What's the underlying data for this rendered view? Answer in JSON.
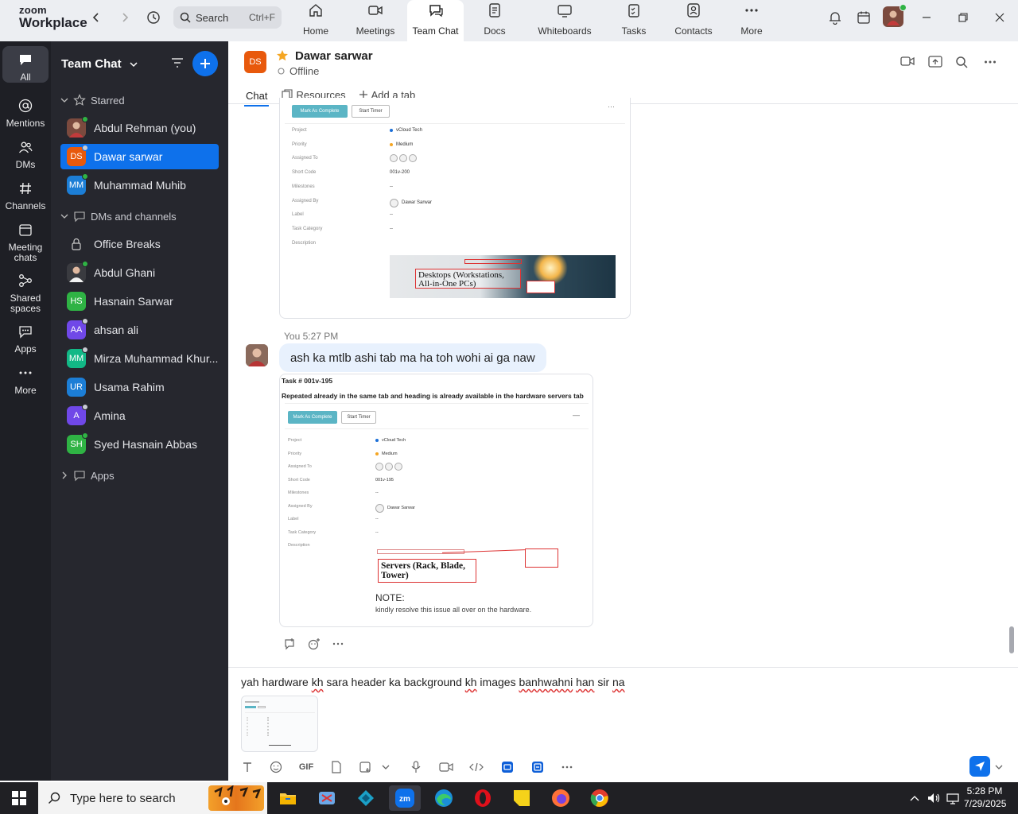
{
  "brand": {
    "line1": "zoom",
    "line2": "Workplace"
  },
  "search": {
    "placeholder": "Search",
    "shortcut": "Ctrl+F"
  },
  "nav_tabs": [
    {
      "label": "Home",
      "icon": "home-icon"
    },
    {
      "label": "Meetings",
      "icon": "video-icon"
    },
    {
      "label": "Team Chat",
      "icon": "chat-icon",
      "active": true
    },
    {
      "label": "Docs",
      "icon": "doc-icon"
    },
    {
      "label": "Whiteboards",
      "icon": "whiteboard-icon"
    },
    {
      "label": "Tasks",
      "icon": "tasks-icon"
    },
    {
      "label": "Contacts",
      "icon": "contacts-icon"
    },
    {
      "label": "More",
      "icon": "more-icon"
    }
  ],
  "rail": [
    {
      "label": "All",
      "icon": "chat-bubble-icon",
      "active": true
    },
    {
      "label": "Mentions",
      "icon": "at-icon"
    },
    {
      "label": "DMs",
      "icon": "people-icon"
    },
    {
      "label": "Channels",
      "icon": "hash-icon"
    },
    {
      "label": "Meeting chats",
      "icon": "calendar-icon"
    },
    {
      "label": "Shared spaces",
      "icon": "share-icon"
    },
    {
      "label": "Apps",
      "icon": "apps-icon"
    },
    {
      "label": "More",
      "icon": "more-icon"
    }
  ],
  "sidebar": {
    "title": "Team Chat",
    "starred_label": "Starred",
    "dms_label": "DMs and channels",
    "apps_label": "Apps",
    "starred": [
      {
        "name": "Abdul Rehman (you)",
        "initials": "",
        "color": "#7b4a3e",
        "status": "#2fb344"
      },
      {
        "name": "Dawar sarwar",
        "initials": "DS",
        "color": "#e8590c",
        "status": "#c9ccd3",
        "selected": true
      },
      {
        "name": "Muhammad Muhib",
        "initials": "MM",
        "color": "#1c7ed6",
        "status": "#2fb344"
      }
    ],
    "dms": [
      {
        "name": "Office Breaks",
        "initials": "",
        "color": "",
        "lock": true
      },
      {
        "name": "Abdul Ghani",
        "initials": "",
        "color": "#3a3b40",
        "status": "#2fb344"
      },
      {
        "name": "Hasnain Sarwar",
        "initials": "HS",
        "color": "#2fb344",
        "status": ""
      },
      {
        "name": "ahsan ali",
        "initials": "AA",
        "color": "#7048e8",
        "status": "#c9ccd3"
      },
      {
        "name": "Mirza Muhammad Khur...",
        "initials": "MM",
        "color": "#12b886",
        "status": "#c9ccd3"
      },
      {
        "name": "Usama Rahim",
        "initials": "UR",
        "color": "#1c7ed6",
        "status": ""
      },
      {
        "name": "Amina",
        "initials": "A",
        "color": "#7048e8",
        "status": "#c9ccd3"
      },
      {
        "name": "Syed Hasnain Abbas",
        "initials": "SH",
        "color": "#2fb344",
        "status": "#2fb344"
      }
    ]
  },
  "chat": {
    "contact_initials": "DS",
    "contact_name": "Dawar sarwar",
    "contact_status": "Offline",
    "tabs": {
      "chat": "Chat",
      "resources": "Resources",
      "add": "Add a tab"
    }
  },
  "card1": {
    "buttons": {
      "complete": "Mark As Complete",
      "timer": "Start Timer"
    },
    "fields": [
      {
        "label": "Project",
        "value": "vCloud Tech"
      },
      {
        "label": "Priority",
        "value": "Medium"
      },
      {
        "label": "Assigned To",
        "value": ""
      },
      {
        "label": "Short Code",
        "value": "001v-200"
      },
      {
        "label": "Milestones",
        "value": "--"
      },
      {
        "label": "Assigned By",
        "value": "Dawar Sarwar"
      },
      {
        "label": "Label",
        "value": "--"
      },
      {
        "label": "Task Category",
        "value": "--"
      },
      {
        "label": "Description",
        "value": ""
      }
    ],
    "banner_text": "Desktops (Workstations, All-in-One PCs)"
  },
  "message": {
    "sender": "You",
    "time": "5:27 PM",
    "text": "ash ka mtlb ashi tab ma ha toh wohi ai ga naw"
  },
  "card2": {
    "task_no": "Task # 001v-195",
    "title": "Repeated already in the same tab and heading is already available in the hardware servers tab",
    "buttons": {
      "complete": "Mark As Complete",
      "timer": "Start Timer"
    },
    "fields": [
      {
        "label": "Project",
        "value": "vCloud Tech"
      },
      {
        "label": "Priority",
        "value": "Medium"
      },
      {
        "label": "Assigned To",
        "value": ""
      },
      {
        "label": "Short Code",
        "value": "001v-195"
      },
      {
        "label": "Milestones",
        "value": "--"
      },
      {
        "label": "Assigned By",
        "value": "Dawar Sarwar"
      },
      {
        "label": "Label",
        "value": "--"
      },
      {
        "label": "Task Category",
        "value": "--"
      },
      {
        "label": "Description",
        "value": ""
      }
    ],
    "banner_text": "Servers (Rack, Blade, Tower)",
    "note_title": "NOTE:",
    "note_text": "kindly resolve this issue all over on the hardware."
  },
  "compose": {
    "text_parts": [
      {
        "t": "yah hardware ",
        "sq": false
      },
      {
        "t": "kh",
        "sq": true
      },
      {
        "t": " sara header ka background ",
        "sq": false
      },
      {
        "t": "kh",
        "sq": true
      },
      {
        "t": " images ",
        "sq": false
      },
      {
        "t": "banhwahni",
        "sq": true
      },
      {
        "t": " ",
        "sq": false
      },
      {
        "t": "han",
        "sq": true
      },
      {
        "t": " sir ",
        "sq": false
      },
      {
        "t": "na",
        "sq": true
      }
    ],
    "gif_label": "GIF"
  },
  "taskbar": {
    "search_placeholder": "Type here to search",
    "time": "5:28 PM",
    "date": "7/29/2025"
  }
}
